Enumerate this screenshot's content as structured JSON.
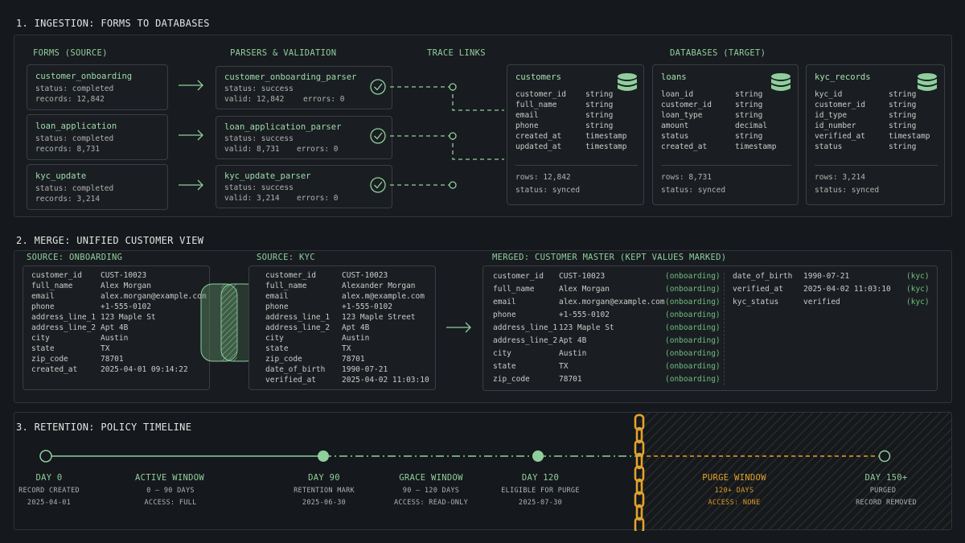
{
  "sections": {
    "ingestion": "1. INGESTION: FORMS TO DATABASES",
    "merge": "2. MERGE: UNIFIED CUSTOMER VIEW",
    "retention": "3. RETENTION: POLICY TIMELINE"
  },
  "ingestion": {
    "col_forms": "FORMS (SOURCE)",
    "col_parsers": "PARSERS & VALIDATION",
    "col_trace": "TRACE LINKS",
    "col_db": "DATABASES (TARGET)",
    "forms": [
      {
        "name": "customer_onboarding",
        "status": "status: completed",
        "records": "records: 12,842"
      },
      {
        "name": "loan_application",
        "status": "status: completed",
        "records": "records: 8,731"
      },
      {
        "name": "kyc_update",
        "status": "status: completed",
        "records": "records: 3,214"
      }
    ],
    "parsers": [
      {
        "name": "customer_onboarding_parser",
        "status": "status: success",
        "valid": "valid: 12,842",
        "errors": "errors: 0"
      },
      {
        "name": "loan_application_parser",
        "status": "status: success",
        "valid": "valid: 8,731",
        "errors": "errors: 0"
      },
      {
        "name": "kyc_update_parser",
        "status": "status: success",
        "valid": "valid: 3,214",
        "errors": "errors: 0"
      }
    ],
    "databases": [
      {
        "name": "customers",
        "fields": [
          [
            "customer_id",
            "string"
          ],
          [
            "full_name",
            "string"
          ],
          [
            "email",
            "string"
          ],
          [
            "phone",
            "string"
          ],
          [
            "created_at",
            "timestamp"
          ],
          [
            "updated_at",
            "timestamp"
          ]
        ],
        "rows": "rows: 12,842",
        "status": "status: synced"
      },
      {
        "name": "loans",
        "fields": [
          [
            "loan_id",
            "string"
          ],
          [
            "customer_id",
            "string"
          ],
          [
            "loan_type",
            "string"
          ],
          [
            "amount",
            "decimal"
          ],
          [
            "status",
            "string"
          ],
          [
            "created_at",
            "timestamp"
          ]
        ],
        "rows": "rows: 8,731",
        "status": "status: synced"
      },
      {
        "name": "kyc_records",
        "fields": [
          [
            "kyc_id",
            "string"
          ],
          [
            "customer_id",
            "string"
          ],
          [
            "id_type",
            "string"
          ],
          [
            "id_number",
            "string"
          ],
          [
            "verified_at",
            "timestamp"
          ],
          [
            "status",
            "string"
          ]
        ],
        "rows": "rows: 3,214",
        "status": "status: synced"
      }
    ]
  },
  "merge": {
    "onboarding_title": "SOURCE: ONBOARDING",
    "kyc_title": "SOURCE: KYC",
    "merged_title": "MERGED: CUSTOMER MASTER (KEPT VALUES MARKED)",
    "onboarding": [
      [
        "customer_id",
        "CUST-10023"
      ],
      [
        "full_name",
        "Alex Morgan"
      ],
      [
        "email",
        "alex.morgan@example.com"
      ],
      [
        "phone",
        "+1-555-0102"
      ],
      [
        "address_line_1",
        "123 Maple St"
      ],
      [
        "address_line_2",
        "Apt 4B"
      ],
      [
        "city",
        "Austin"
      ],
      [
        "state",
        "TX"
      ],
      [
        "zip_code",
        "78701"
      ],
      [
        "created_at",
        "2025-04-01 09:14:22"
      ]
    ],
    "kyc": [
      [
        "customer_id",
        "CUST-10023"
      ],
      [
        "full_name",
        "Alexander Morgan"
      ],
      [
        "email",
        "alex.m@example.com"
      ],
      [
        "phone",
        "+1-555-0102"
      ],
      [
        "address_line_1",
        "123 Maple Street"
      ],
      [
        "address_line_2",
        "Apt 4B"
      ],
      [
        "city",
        "Austin"
      ],
      [
        "state",
        "TX"
      ],
      [
        "zip_code",
        "78701"
      ],
      [
        "date_of_birth",
        "1990-07-21"
      ],
      [
        "verified_at",
        "2025-04-02 11:03:10"
      ]
    ],
    "merged_left": [
      [
        "customer_id",
        "CUST-10023",
        "(onboarding)"
      ],
      [
        "full_name",
        "Alex Morgan",
        "(onboarding)"
      ],
      [
        "email",
        "alex.morgan@example.com",
        "(onboarding)"
      ],
      [
        "phone",
        "+1-555-0102",
        "(onboarding)"
      ],
      [
        "address_line_1",
        "123 Maple St",
        "(onboarding)"
      ],
      [
        "address_line_2",
        "Apt 4B",
        "(onboarding)"
      ],
      [
        "city",
        "Austin",
        "(onboarding)"
      ],
      [
        "state",
        "TX",
        "(onboarding)"
      ],
      [
        "zip_code",
        "78701",
        "(onboarding)"
      ]
    ],
    "merged_right": [
      [
        "date_of_birth",
        "1990-07-21",
        "(kyc)"
      ],
      [
        "verified_at",
        "2025-04-02 11:03:10",
        "(kyc)"
      ],
      [
        "kyc_status",
        "verified",
        "(kyc)"
      ]
    ]
  },
  "retention": {
    "points": [
      {
        "day": "DAY 0",
        "label": "RECORD CREATED",
        "date": "2025-04-01"
      },
      {
        "day": "DAY 90",
        "label": "RETENTION MARK",
        "date": "2025-06-30"
      },
      {
        "day": "DAY 120",
        "label": "ELIGIBLE FOR PURGE",
        "date": "2025-07-30"
      },
      {
        "day": "DAY 150+",
        "label": "PURGED",
        "date": "RECORD REMOVED"
      }
    ],
    "windows": [
      {
        "title": "ACTIVE WINDOW",
        "range": "0 – 90 DAYS",
        "access": "ACCESS: FULL"
      },
      {
        "title": "GRACE WINDOW",
        "range": "90 – 120 DAYS",
        "access": "ACCESS: READ-ONLY"
      },
      {
        "title": "PURGE WINDOW",
        "range": "120+ DAYS",
        "access": "ACCESS: NONE"
      }
    ]
  },
  "colors": {
    "accent": "#8fcf9c",
    "gold": "#e2a32c",
    "background": "#15181c"
  },
  "icons": [
    "arrow-right-icon",
    "check-circle-icon",
    "database-icon",
    "chain-icon"
  ]
}
